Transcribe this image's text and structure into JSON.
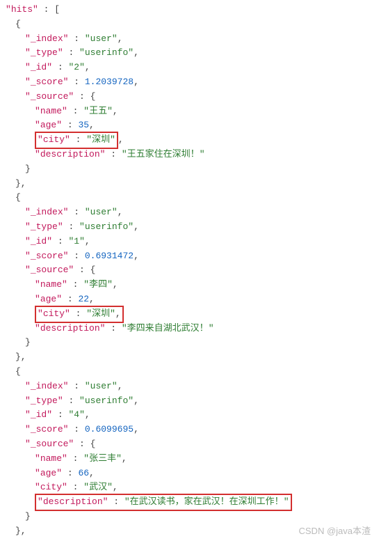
{
  "root_key": "hits",
  "hits": [
    {
      "index_key": "_index",
      "index_val": "user",
      "type_key": "_type",
      "type_val": "userinfo",
      "id_key": "_id",
      "id_val": "2",
      "score_key": "_score",
      "score_val": "1.2039728",
      "source_key": "_source",
      "name_key": "name",
      "name_val": "王五",
      "age_key": "age",
      "age_val": "35",
      "city_key": "city",
      "city_val": "深圳",
      "desc_key": "description",
      "desc_val": "王五家住在深圳！",
      "highlight_city": true,
      "highlight_desc": false
    },
    {
      "index_key": "_index",
      "index_val": "user",
      "type_key": "_type",
      "type_val": "userinfo",
      "id_key": "_id",
      "id_val": "1",
      "score_key": "_score",
      "score_val": "0.6931472",
      "source_key": "_source",
      "name_key": "name",
      "name_val": "李四",
      "age_key": "age",
      "age_val": "22",
      "city_key": "city",
      "city_val": "深圳",
      "desc_key": "description",
      "desc_val": "李四来自湖北武汉！",
      "highlight_city": true,
      "highlight_desc": false
    },
    {
      "index_key": "_index",
      "index_val": "user",
      "type_key": "_type",
      "type_val": "userinfo",
      "id_key": "_id",
      "id_val": "4",
      "score_key": "_score",
      "score_val": "0.6099695",
      "source_key": "_source",
      "name_key": "name",
      "name_val": "张三丰",
      "age_key": "age",
      "age_val": "66",
      "city_key": "city",
      "city_val": "武汉",
      "desc_key": "description",
      "desc_val": "在武汉读书，家在武汉！在深圳工作！",
      "highlight_city": false,
      "highlight_desc": true
    }
  ],
  "watermark": "CSDN @java本渣"
}
